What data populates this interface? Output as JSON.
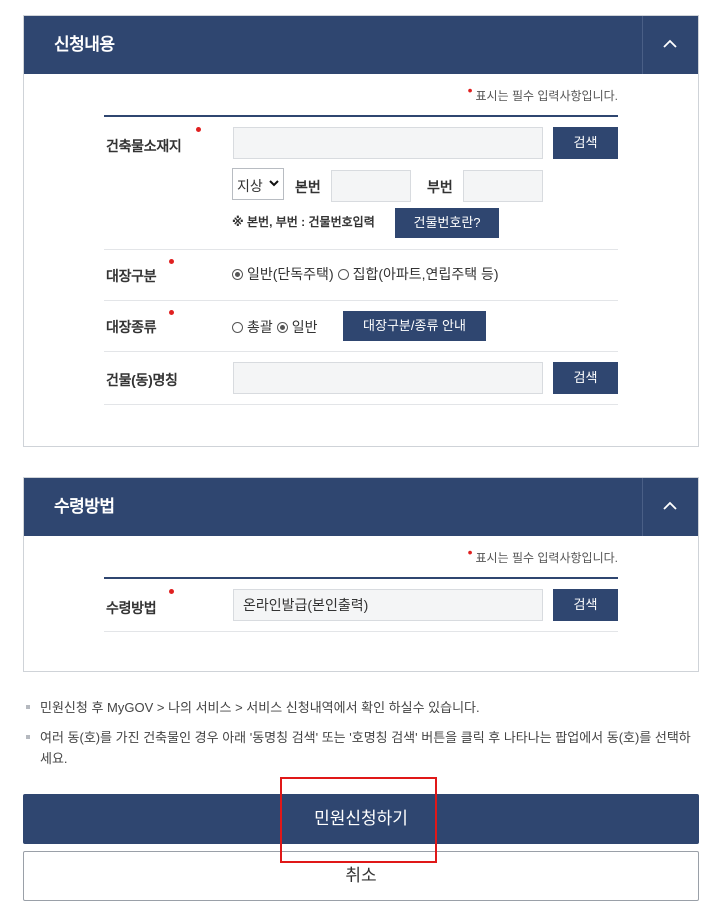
{
  "section1": {
    "title": "신청내용",
    "required_note": "표시는 필수 입력사항입니다.",
    "address": {
      "label": "건축물소재지",
      "value": "",
      "search_label": "검색",
      "land_type": "지상",
      "main_no_label": "본번",
      "main_no_value": "",
      "sub_no_label": "부번",
      "sub_no_value": "",
      "hint": "※ 본번, 부번 : 건물번호입력",
      "help_button": "건물번호란?"
    },
    "ledger_type": {
      "label": "대장구분",
      "options": [
        "일반(단독주택)",
        "집합(아파트,연립주택 등)"
      ],
      "selected": "일반(단독주택)"
    },
    "ledger_kind": {
      "label": "대장종류",
      "options": [
        "총괄",
        "일반"
      ],
      "selected": "일반",
      "guide_button": "대장구분/종류 안내"
    },
    "building_name": {
      "label": "건물(동)명칭",
      "value": "",
      "search_label": "검색"
    }
  },
  "section2": {
    "title": "수령방법",
    "required_note": "표시는 필수 입력사항입니다.",
    "receive": {
      "label": "수령방법",
      "value": "온라인발급(본인출력)",
      "search_label": "검색"
    }
  },
  "notices": [
    "민원신청 후 MyGOV > 나의 서비스 > 서비스 신청내역에서 확인 하실수 있습니다.",
    "여러 동(호)를 가진 건축물인 경우 아래 '동명칭 검색' 또는 '호명칭 검색' 버튼을 클릭 후 나타나는 팝업에서 동(호)를 선택하세요."
  ],
  "actions": {
    "submit": "민원신청하기",
    "cancel": "취소"
  },
  "colors": {
    "primary": "#2f4670",
    "required": "#e02020",
    "highlight": "#e01818"
  }
}
